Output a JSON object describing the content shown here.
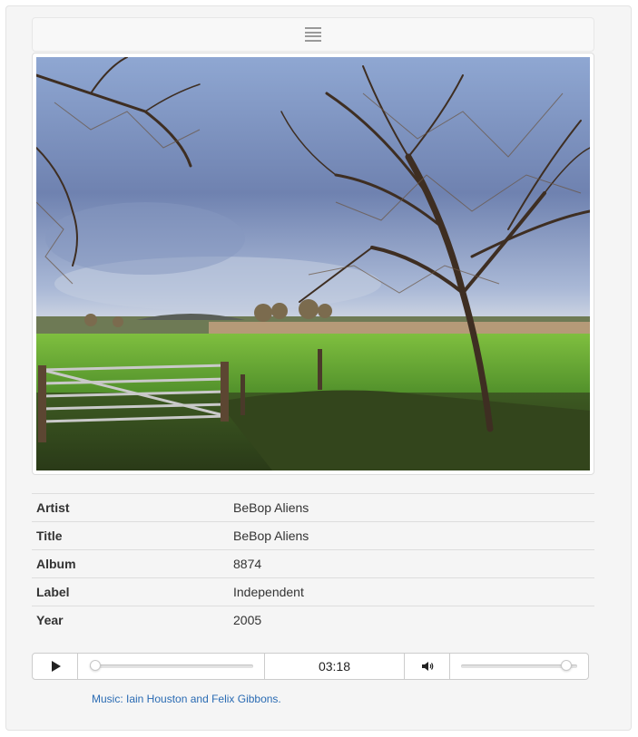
{
  "menu": {
    "icon": "hamburger-menu-icon"
  },
  "image": {
    "subject": "landscape-photo"
  },
  "metadata": {
    "rows": [
      {
        "key": "Artist",
        "value": "BeBop Aliens"
      },
      {
        "key": "Title",
        "value": "BeBop Aliens"
      },
      {
        "key": "Album",
        "value": "8874"
      },
      {
        "key": "Label",
        "value": "Independent"
      },
      {
        "key": "Year",
        "value": "2005"
      }
    ]
  },
  "player": {
    "play_icon": "play-icon",
    "time": "03:18",
    "volume_icon": "speaker-icon",
    "seek_fraction": 0,
    "volume_fraction": 0.95
  },
  "credit": {
    "text": "Music: Iain Houston and Felix Gibbons."
  },
  "colors": {
    "link": "#2a6bb3",
    "panel_bg": "#f5f5f5",
    "border": "#dddddd"
  }
}
